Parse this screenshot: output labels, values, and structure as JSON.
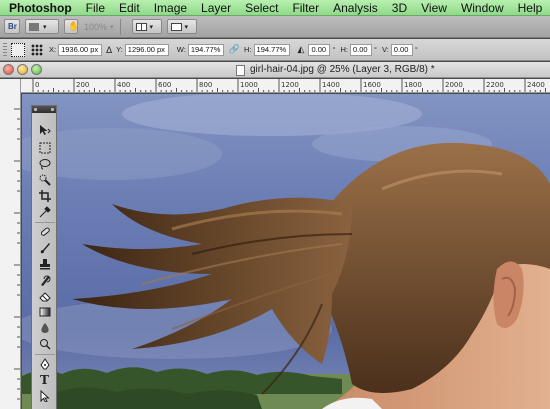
{
  "menubar": {
    "app": "Photoshop",
    "items": [
      "File",
      "Edit",
      "Image",
      "Layer",
      "Select",
      "Filter",
      "Analysis",
      "3D",
      "View",
      "Window",
      "Help"
    ]
  },
  "appbar": {
    "zoom": "100%"
  },
  "options": {
    "x_label": "X:",
    "x_value": "1936.00 px",
    "y_label": "Y:",
    "y_value": "1296.00 px",
    "w_label": "W:",
    "w_value": "194.77%",
    "h_label": "H:",
    "h_value": "194.77%",
    "angle_value": "0.00",
    "angle_unit": "°",
    "hskew_label": "H:",
    "hskew_value": "0.00",
    "hskew_unit": "°",
    "vskew_label": "V:",
    "vskew_value": "0.00",
    "vskew_unit": "°"
  },
  "document": {
    "title": "girl-hair-04.jpg @ 25% (Layer 3, RGB/8) *"
  },
  "ruler": {
    "labels": [
      "0",
      "200",
      "400",
      "600",
      "800",
      "1000",
      "1200",
      "1400",
      "1600",
      "1800",
      "2000",
      "2200",
      "2400"
    ]
  },
  "tools": [
    "move-tool",
    "marquee-tool",
    "lasso-tool",
    "quick-selection-tool",
    "crop-tool",
    "eyedropper-tool",
    "healing-brush-tool",
    "brush-tool",
    "clone-stamp-tool",
    "history-brush-tool",
    "eraser-tool",
    "gradient-tool",
    "blur-tool",
    "dodge-tool",
    "pen-tool",
    "type-tool",
    "path-selection-tool"
  ],
  "colors": {
    "menubar": "#9fe39a",
    "sky": "#5b6fa8",
    "hair": "#6b4a2c",
    "skin": "#d9a583"
  }
}
